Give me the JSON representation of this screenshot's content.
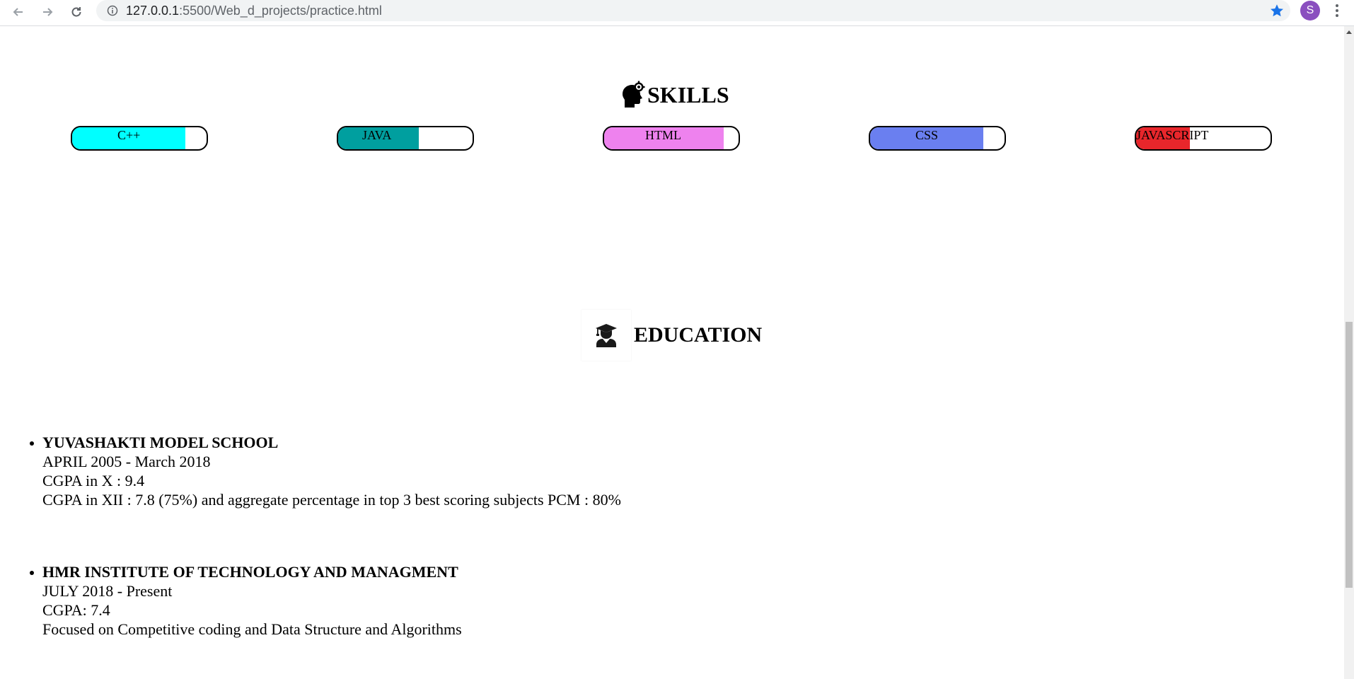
{
  "browser": {
    "url_host": "127.0.0.1",
    "url_rest": ":5500/Web_d_projects/practice.html",
    "profile_initial": "S"
  },
  "skills": {
    "title": "SKILLS",
    "items": [
      {
        "label": "C++",
        "color": "#00ffff",
        "level": 0.84
      },
      {
        "label": "JAVA",
        "color": "#009f9f",
        "level": 0.6
      },
      {
        "label": "HTML",
        "color": "#ee82ee",
        "level": 0.89
      },
      {
        "label": "CSS",
        "color": "#6a7ff0",
        "level": 0.84
      },
      {
        "label": "JAVASCRIPT",
        "color": "#e8262b",
        "level": 0.4
      }
    ]
  },
  "education": {
    "title": "EDUCATION",
    "entries": [
      {
        "school": "YUVASHAKTI MODEL SCHOOL",
        "period": "APRIL 2005 - March 2018",
        "line1": "CGPA in X : 9.4",
        "line2": "CGPA in XII : 7.8 (75%) and aggregate percentage in top 3 best scoring subjects PCM : 80%"
      },
      {
        "school": "HMR INSTITUTE OF TECHNOLOGY AND MANAGMENT",
        "period": "JULY 2018 - Present",
        "line1": "CGPA: 7.4",
        "line2": "Focused on Competitive coding and Data Structure and Algorithms"
      }
    ]
  }
}
